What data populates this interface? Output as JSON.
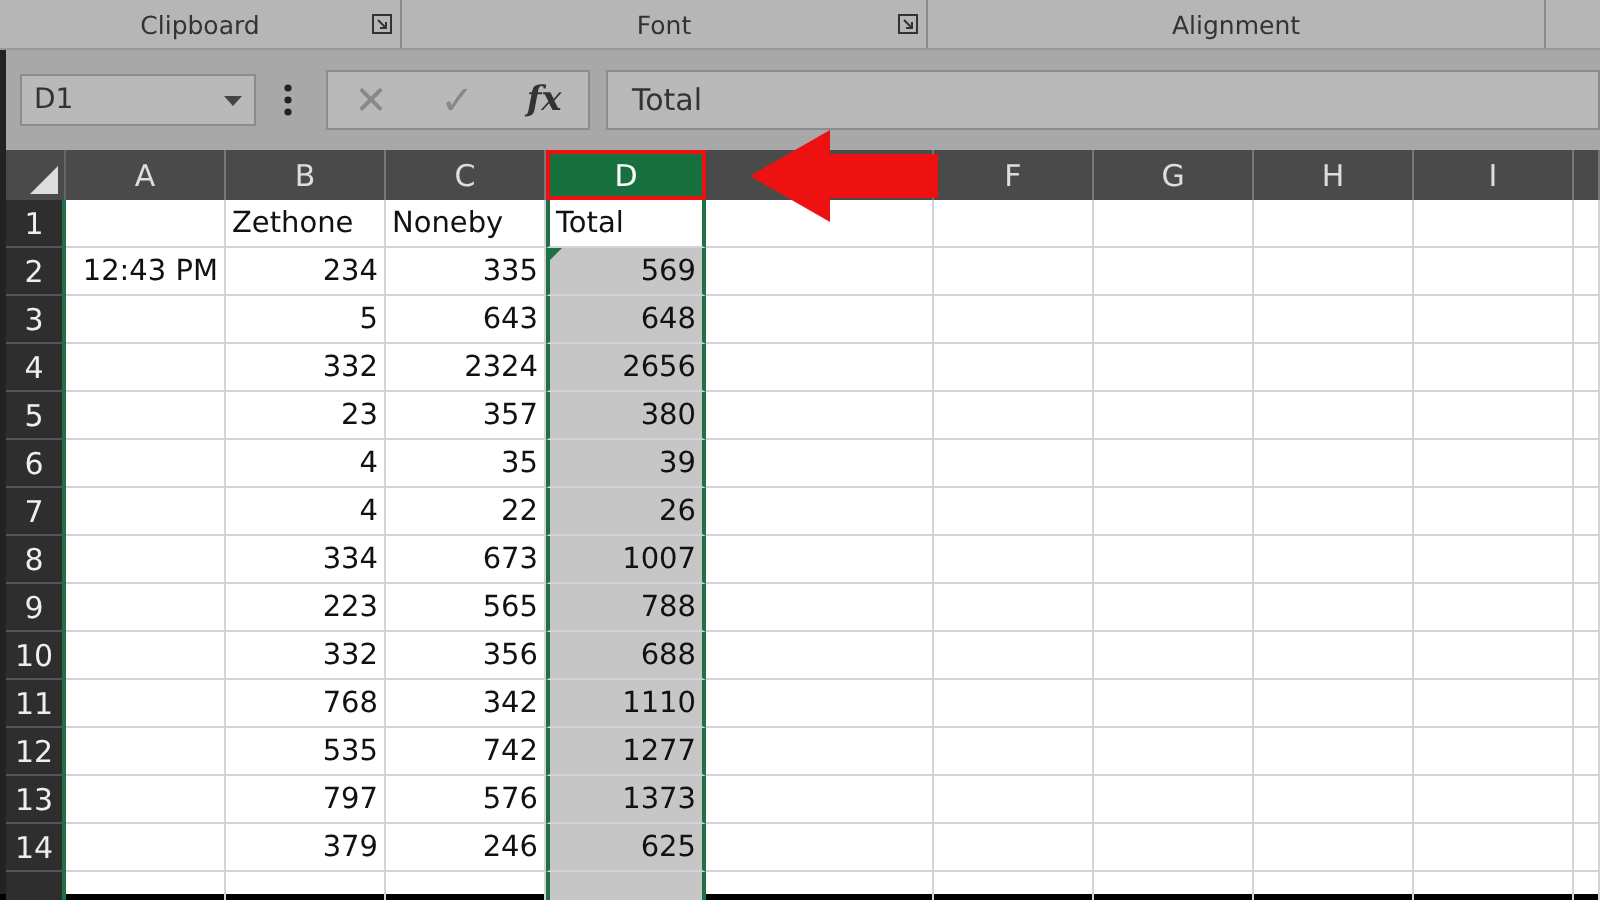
{
  "ribbon_groups": [
    {
      "label": "Clipboard",
      "launcher": true
    },
    {
      "label": "Font",
      "launcher": true
    },
    {
      "label": "Alignment",
      "launcher": false
    }
  ],
  "name_box": {
    "value": "D1"
  },
  "formula_bar": {
    "cancel": "✕",
    "enter": "✓",
    "function": "fx",
    "value": "Total"
  },
  "columns": [
    {
      "label": "A",
      "selected": false
    },
    {
      "label": "B",
      "selected": false
    },
    {
      "label": "C",
      "selected": false
    },
    {
      "label": "D",
      "selected": true
    },
    {
      "selected": false
    },
    {
      "label": "F",
      "selected": false
    },
    {
      "label": "G",
      "selected": false
    },
    {
      "label": "H",
      "selected": false
    },
    {
      "label": "I",
      "selected": false
    }
  ],
  "rows": [
    {
      "number": "1",
      "B": {
        "text": "Zethone",
        "kind": "text"
      },
      "C": {
        "text": "Noneby",
        "kind": "text"
      },
      "D": {
        "text": "Total",
        "kind": "text",
        "active": true
      }
    },
    {
      "number": "2",
      "A": {
        "text": "12:43 PM",
        "kind": "number"
      },
      "B": {
        "text": "234",
        "kind": "number"
      },
      "C": {
        "text": "335",
        "kind": "number"
      },
      "D": {
        "text": "569",
        "kind": "number",
        "error_flag": true
      }
    },
    {
      "number": "3",
      "B": {
        "text": "5",
        "kind": "number"
      },
      "C": {
        "text": "643",
        "kind": "number"
      },
      "D": {
        "text": "648",
        "kind": "number"
      }
    },
    {
      "number": "4",
      "B": {
        "text": "332",
        "kind": "number"
      },
      "C": {
        "text": "2324",
        "kind": "number"
      },
      "D": {
        "text": "2656",
        "kind": "number"
      }
    },
    {
      "number": "5",
      "B": {
        "text": "23",
        "kind": "number"
      },
      "C": {
        "text": "357",
        "kind": "number"
      },
      "D": {
        "text": "380",
        "kind": "number"
      }
    },
    {
      "number": "6",
      "B": {
        "text": "4",
        "kind": "number"
      },
      "C": {
        "text": "35",
        "kind": "number"
      },
      "D": {
        "text": "39",
        "kind": "number"
      }
    },
    {
      "number": "7",
      "B": {
        "text": "4",
        "kind": "number"
      },
      "C": {
        "text": "22",
        "kind": "number"
      },
      "D": {
        "text": "26",
        "kind": "number"
      }
    },
    {
      "number": "8",
      "B": {
        "text": "334",
        "kind": "number"
      },
      "C": {
        "text": "673",
        "kind": "number"
      },
      "D": {
        "text": "1007",
        "kind": "number"
      }
    },
    {
      "number": "9",
      "B": {
        "text": "223",
        "kind": "number"
      },
      "C": {
        "text": "565",
        "kind": "number"
      },
      "D": {
        "text": "788",
        "kind": "number"
      }
    },
    {
      "number": "10",
      "B": {
        "text": "332",
        "kind": "number"
      },
      "C": {
        "text": "356",
        "kind": "number"
      },
      "D": {
        "text": "688",
        "kind": "number"
      }
    },
    {
      "number": "11",
      "B": {
        "text": "768",
        "kind": "number"
      },
      "C": {
        "text": "342",
        "kind": "number"
      },
      "D": {
        "text": "1110",
        "kind": "number"
      }
    },
    {
      "number": "12",
      "B": {
        "text": "535",
        "kind": "number"
      },
      "C": {
        "text": "742",
        "kind": "number"
      },
      "D": {
        "text": "1277",
        "kind": "number"
      }
    },
    {
      "number": "13",
      "B": {
        "text": "797",
        "kind": "number"
      },
      "C": {
        "text": "576",
        "kind": "number"
      },
      "D": {
        "text": "1373",
        "kind": "number"
      }
    },
    {
      "number": "14",
      "B": {
        "text": "379",
        "kind": "number"
      },
      "C": {
        "text": "246",
        "kind": "number"
      },
      "D": {
        "text": "625",
        "kind": "number"
      }
    }
  ]
}
